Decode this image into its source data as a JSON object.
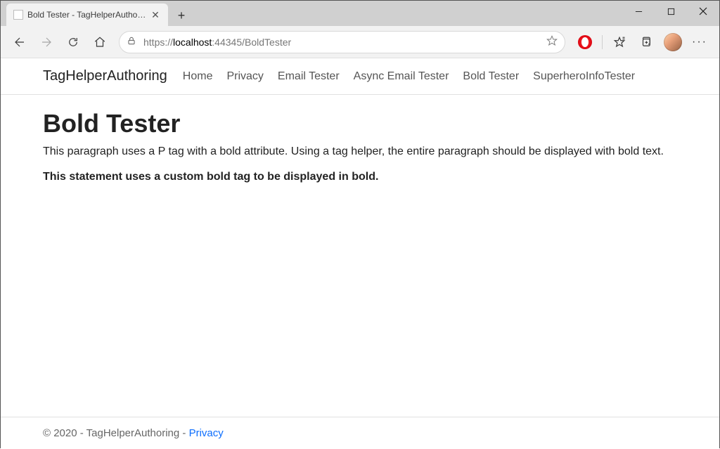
{
  "window": {
    "tab_title": "Bold Tester - TagHelperAuthoring"
  },
  "address": {
    "scheme": "https://",
    "host": "localhost",
    "rest": ":44345/BoldTester"
  },
  "nav": {
    "brand": "TagHelperAuthoring",
    "items": [
      "Home",
      "Privacy",
      "Email Tester",
      "Async Email Tester",
      "Bold Tester",
      "SuperheroInfoTester"
    ]
  },
  "page": {
    "heading": "Bold Tester",
    "paragraph": "This paragraph uses a P tag with a bold attribute. Using a tag helper, the entire paragraph should be displayed with bold text.",
    "bold_statement": "This statement uses a custom bold tag to be displayed in bold."
  },
  "footer": {
    "copyright": "© 2020 - TagHelperAuthoring - ",
    "privacy_label": "Privacy"
  }
}
